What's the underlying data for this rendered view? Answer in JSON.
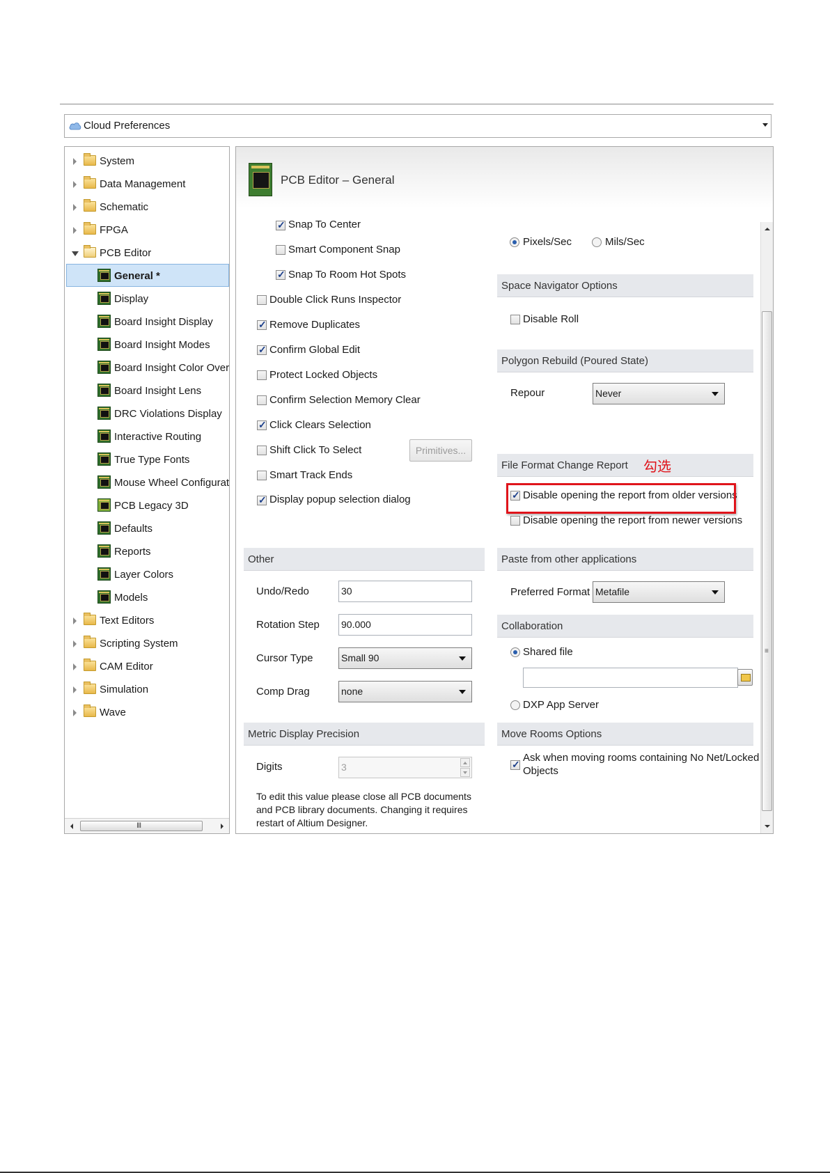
{
  "top": {
    "label": "Cloud Preferences"
  },
  "tree": {
    "items": [
      {
        "label": "System"
      },
      {
        "label": "Data Management"
      },
      {
        "label": "Schematic"
      },
      {
        "label": "FPGA"
      },
      {
        "label": "PCB Editor"
      },
      {
        "label": "General *"
      },
      {
        "label": "Display"
      },
      {
        "label": "Board Insight Display"
      },
      {
        "label": "Board Insight Modes"
      },
      {
        "label": "Board Insight Color Overrid"
      },
      {
        "label": "Board Insight Lens"
      },
      {
        "label": "DRC Violations Display"
      },
      {
        "label": "Interactive Routing"
      },
      {
        "label": "True Type Fonts"
      },
      {
        "label": "Mouse Wheel Configuratior"
      },
      {
        "label": "PCB Legacy 3D"
      },
      {
        "label": "Defaults"
      },
      {
        "label": "Reports"
      },
      {
        "label": "Layer Colors"
      },
      {
        "label": "Models"
      },
      {
        "label": "Text Editors"
      },
      {
        "label": "Scripting System"
      },
      {
        "label": "CAM Editor"
      },
      {
        "label": "Simulation"
      },
      {
        "label": "Wave"
      }
    ],
    "scroll_grip": "III"
  },
  "panel": {
    "title": "PCB Editor – General",
    "left_checks": [
      {
        "label": "Snap To Center",
        "checked": true
      },
      {
        "label": "Smart Component Snap",
        "checked": false
      },
      {
        "label": "Snap To Room Hot Spots",
        "checked": true
      },
      {
        "label": "Double Click Runs Inspector",
        "checked": false
      },
      {
        "label": "Remove Duplicates",
        "checked": true
      },
      {
        "label": "Confirm Global Edit",
        "checked": true
      },
      {
        "label": "Protect Locked Objects",
        "checked": false
      },
      {
        "label": "Confirm Selection Memory Clear",
        "checked": false
      },
      {
        "label": "Click Clears Selection",
        "checked": true
      },
      {
        "label": "Shift Click To Select",
        "checked": false
      },
      {
        "label": "Smart Track Ends",
        "checked": false
      },
      {
        "label": "Display popup selection dialog",
        "checked": true
      }
    ],
    "primitives_button": "Primitives...",
    "other": {
      "header": "Other",
      "undo_label": "Undo/Redo",
      "undo_value": "30",
      "rotation_label": "Rotation Step",
      "rotation_value": "90.000",
      "cursor_label": "Cursor Type",
      "cursor_value": "Small 90",
      "compdrag_label": "Comp Drag",
      "compdrag_value": "none"
    },
    "metric": {
      "header": "Metric Display Precision",
      "digits_label": "Digits",
      "digits_value": "3",
      "note_line1": "To edit this value please close all PCB documents",
      "note_line2": "and PCB library documents. Changing it requires",
      "note_line3": "restart of Altium Designer."
    },
    "speed": {
      "pixels": "Pixels/Sec",
      "mils": "Mils/Sec"
    },
    "space_nav": {
      "header": "Space Navigator Options",
      "disable_roll": "Disable Roll"
    },
    "polygon": {
      "header": "Polygon Rebuild (Poured State)",
      "repour_label": "Repour",
      "repour_value": "Never"
    },
    "file_format": {
      "header": "File Format Change Report",
      "annotation": "勾选",
      "older": "Disable opening the report from older versions",
      "newer": "Disable opening the report from newer versions"
    },
    "paste": {
      "header": "Paste from other applications",
      "pref_label": "Preferred Format",
      "pref_value": "Metafile"
    },
    "collab": {
      "header": "Collaboration",
      "shared": "Shared file",
      "dxp": "DXP App Server"
    },
    "move_rooms": {
      "header": "Move Rooms Options",
      "line1": "Ask when moving rooms containing No Net/Locked",
      "line2": "Objects"
    }
  },
  "colors": {
    "highlight": "#e0141b",
    "selection": "#cfe4f8",
    "section_bg": "#e6e8ec"
  }
}
